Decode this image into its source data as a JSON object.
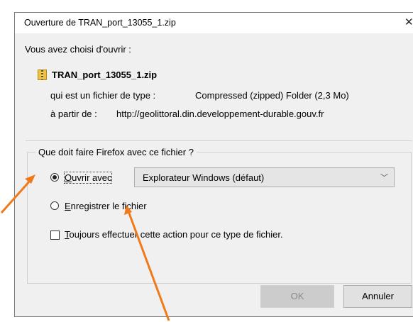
{
  "dialog": {
    "title": "Ouverture de TRAN_port_13055_1.zip",
    "close_icon": "close-icon"
  },
  "intro": "Vous avez choisi d'ouvrir :",
  "file": {
    "icon": "zip-folder-icon",
    "name": "TRAN_port_13055_1.zip",
    "type_label": "qui est un fichier de type :",
    "type_value": "Compressed (zipped) Folder (2,3 Mo)",
    "source_label": "à partir de :",
    "source_value": "http://geolittoral.din.developpement-durable.gouv.fr"
  },
  "action_group": {
    "legend": "Que doit faire Firefox avec ce fichier ?",
    "open_with": {
      "label": "Ouvrir avec",
      "checked": true,
      "selected_app": "Explorateur Windows (défaut)"
    },
    "save_file": {
      "label": "Enregistrer le fichier",
      "checked": false
    },
    "always": {
      "label": "Toujours effectuer cette action pour ce type de fichier.",
      "checked": false
    }
  },
  "buttons": {
    "ok": "OK",
    "cancel": "Annuler"
  },
  "annotation_color": "#f07a1a"
}
